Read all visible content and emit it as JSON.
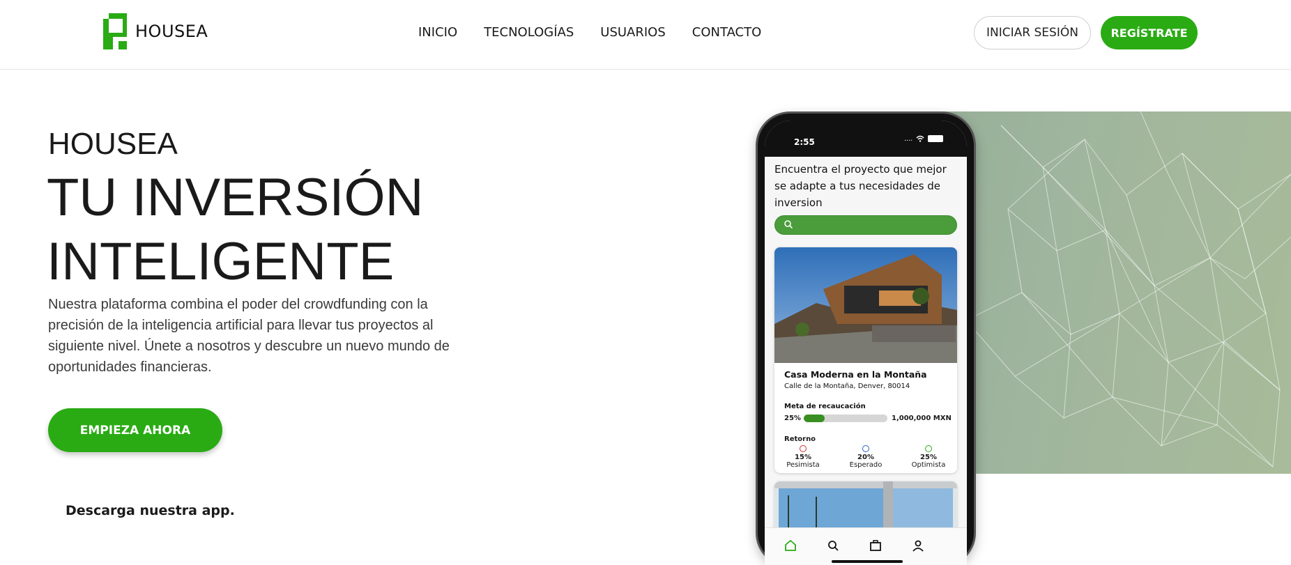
{
  "brand": {
    "name": "HOUSEA",
    "accent": "#2aab14"
  },
  "nav": {
    "items": [
      "INICIO",
      "TECNOLOGÍAS",
      "USUARIOS",
      "CONTACTO"
    ],
    "login_label": "INICIAR SESIÓN",
    "register_label": "REGÍSTRATE"
  },
  "hero": {
    "eyebrow": "HOUSEA",
    "headline_line1": "TU INVERSIÓN",
    "headline_line2": "INTELIGENTE",
    "description": "Nuestra plataforma combina el poder del crowdfunding con la precisión de la inteligencia artificial para llevar tus proyectos al siguiente nivel. Únete a nosotros y descubre un nuevo mundo de oportunidades financieras.",
    "cta_label": "EMPIEZA AHORA",
    "download_label": "Descarga nuestra app."
  },
  "phone": {
    "time": "2:55",
    "signal": "....",
    "heading": "Encuentra el proyecto que mejor se adapte a tus necesidades de inversion",
    "search_icon": "search-icon",
    "card": {
      "title": "Casa Moderna en la Montaña",
      "address": "Calle de la Montaña, Denver, 80014",
      "goal_label": "Meta de recaucación",
      "goal_percent": "25%",
      "goal_fraction": 0.25,
      "goal_amount": "1,000,000 MXN",
      "returns_label": "Retorno",
      "returns": [
        {
          "percent": "15%",
          "label": "Pesimista",
          "color": "#d03030"
        },
        {
          "percent": "20%",
          "label": "Esperado",
          "color": "#2a5fc8"
        },
        {
          "percent": "25%",
          "label": "Optimista",
          "color": "#2aab14"
        }
      ]
    },
    "tabs": [
      "home-icon",
      "search-icon",
      "briefcase-icon",
      "user-icon"
    ]
  }
}
